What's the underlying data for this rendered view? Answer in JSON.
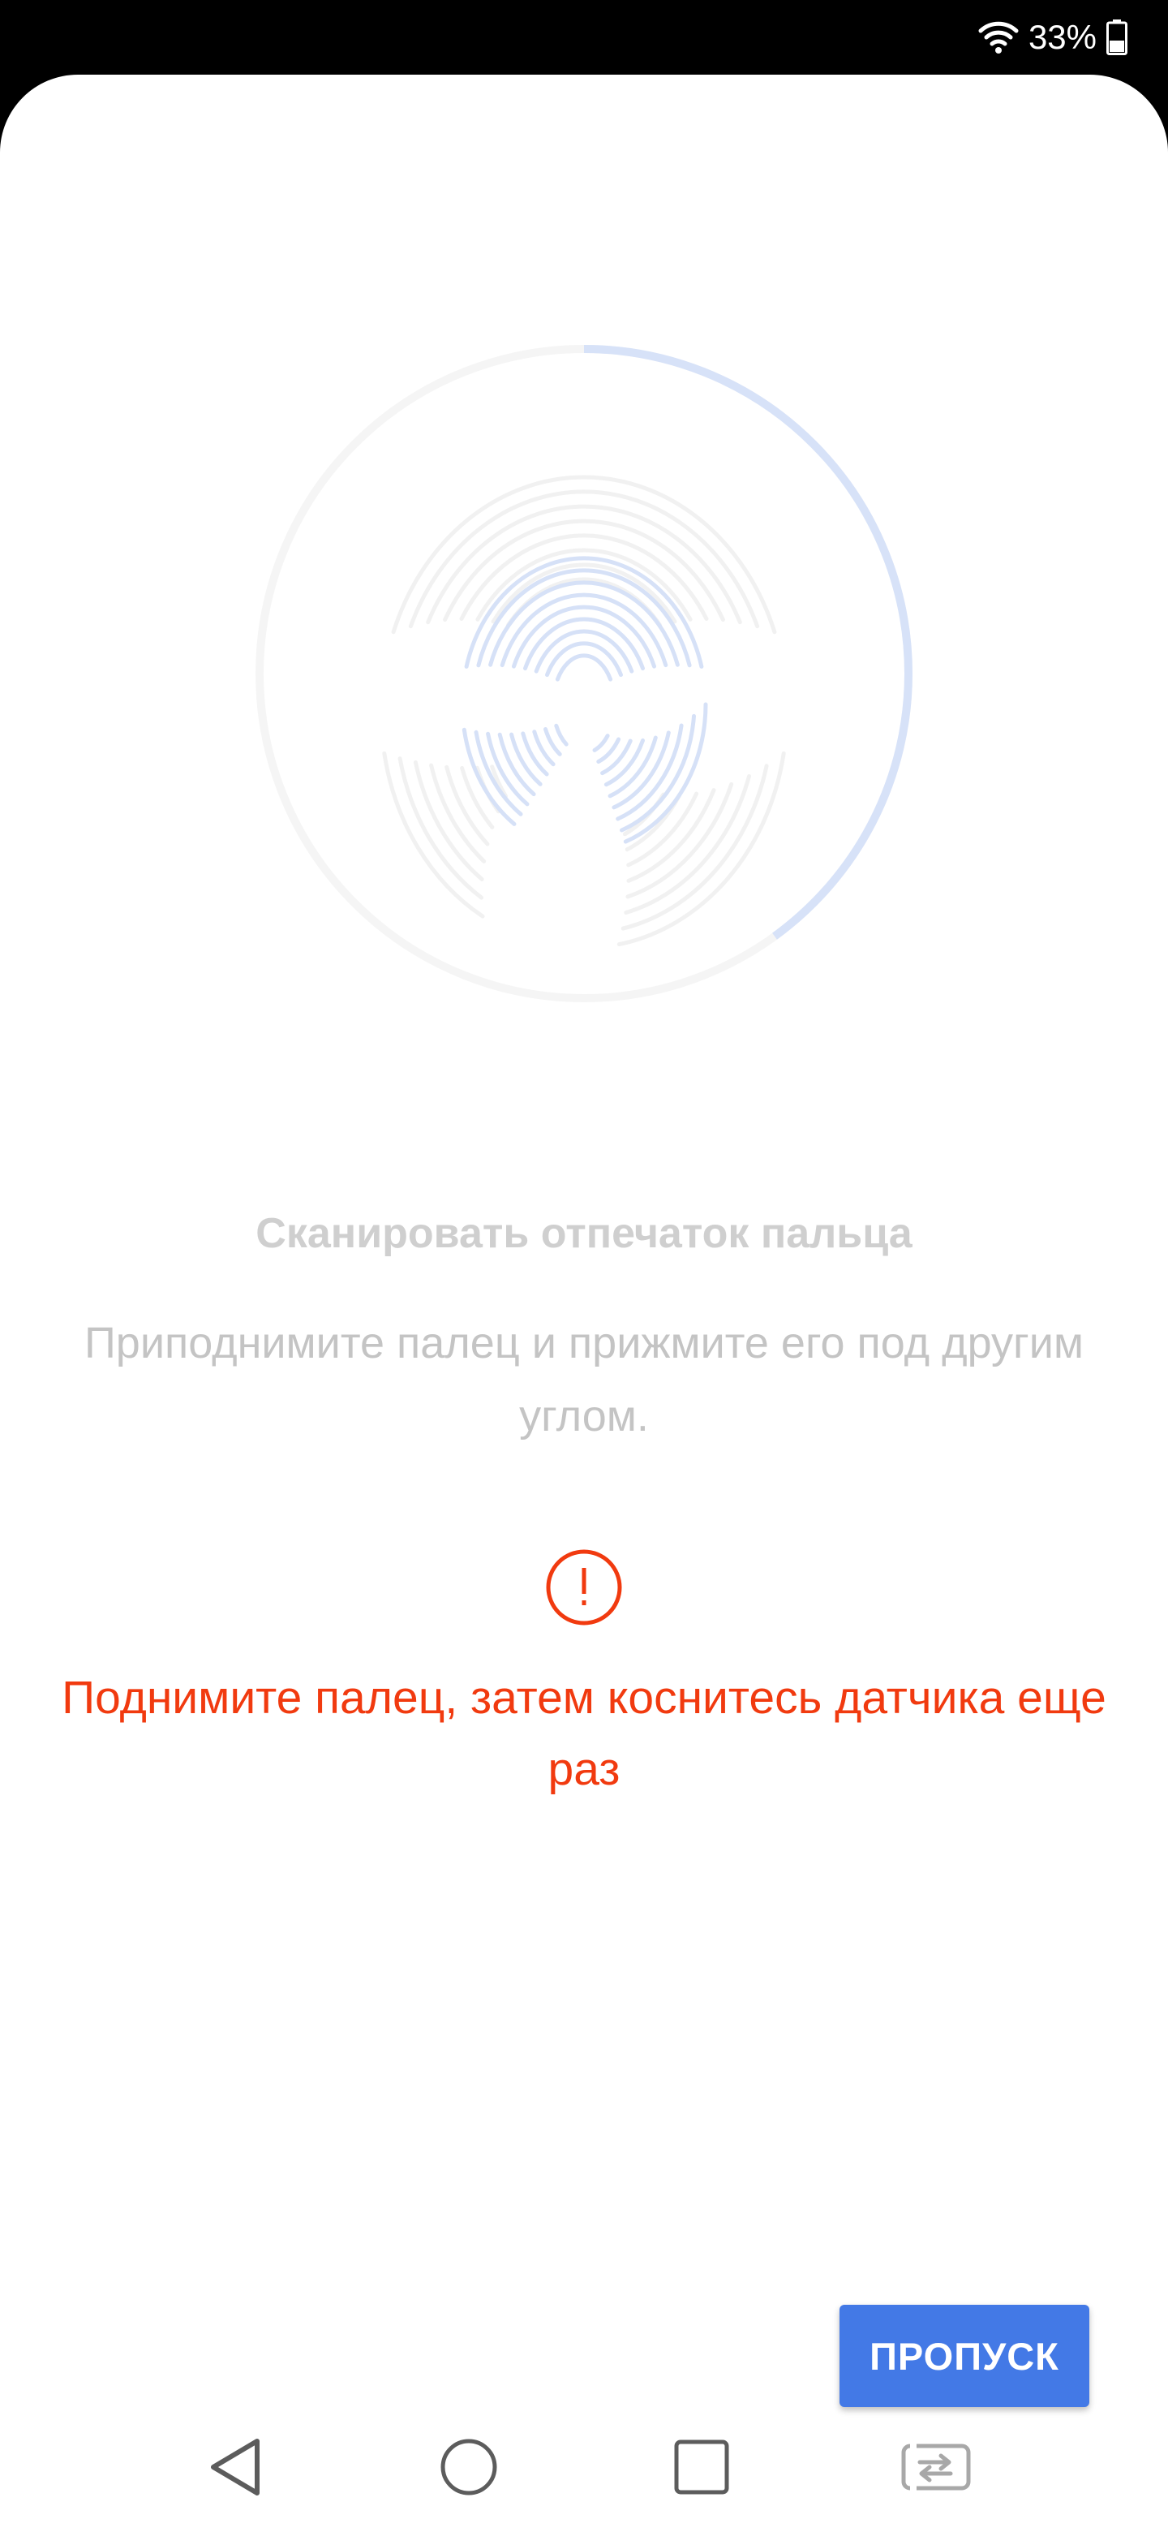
{
  "status_bar": {
    "battery_text": "33%",
    "icons": [
      "wifi-icon",
      "battery-icon"
    ]
  },
  "enrollment": {
    "progress": 0.4,
    "progress_color": "#d7e2f8",
    "title": "Сканировать отпечаток пальца",
    "instruction": "Приподнимите палец и прижмите его под другим углом.",
    "warning_icon": "alert-circle-icon",
    "error": "Поднимите палец, затем коснитесь датчика еще раз",
    "error_color": "#f13a0f"
  },
  "actions": {
    "skip_label": "ПРОПУСК",
    "accent": "#4379e6"
  },
  "nav_bar": {
    "buttons": [
      "back-icon",
      "home-icon",
      "recents-icon",
      "switch-icon"
    ]
  }
}
